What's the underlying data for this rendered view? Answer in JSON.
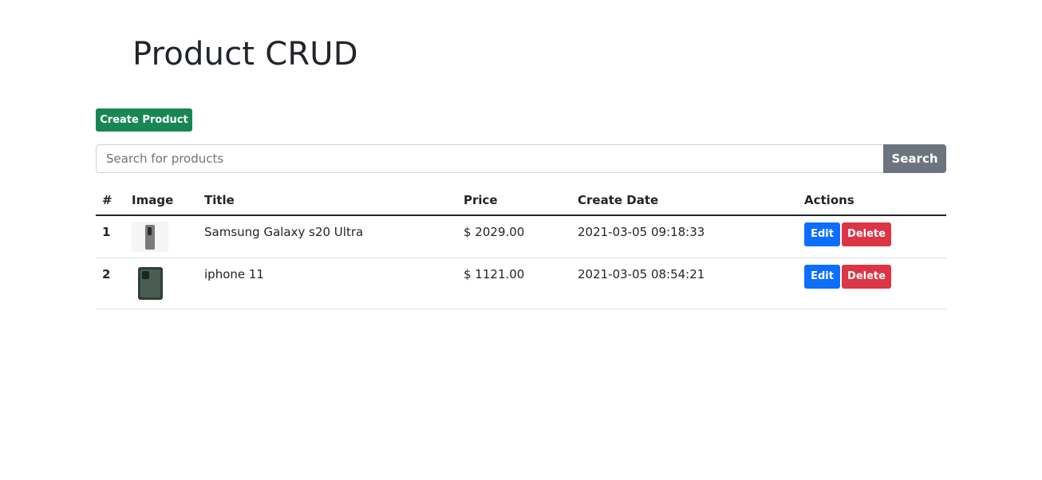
{
  "page": {
    "title": "Product CRUD",
    "create_label": "Create Product"
  },
  "search": {
    "placeholder": "Search for products",
    "button_label": "Search"
  },
  "table": {
    "headers": {
      "num": "#",
      "image": "Image",
      "title": "Title",
      "price": "Price",
      "create_date": "Create Date",
      "actions": "Actions"
    },
    "rows": [
      {
        "num": "1",
        "image_icon": "samsung-phone-thumbnail",
        "title": "Samsung Galaxy s20 Ultra",
        "price": "$ 2029.00",
        "create_date": "2021-03-05 09:18:33",
        "edit_label": "Edit",
        "delete_label": "Delete"
      },
      {
        "num": "2",
        "image_icon": "iphone-thumbnail",
        "title": "iphone 11",
        "price": "$ 1121.00",
        "create_date": "2021-03-05 08:54:21",
        "edit_label": "Edit",
        "delete_label": "Delete"
      }
    ]
  },
  "colors": {
    "create": "#198754",
    "search": "#6c757d",
    "edit": "#0d6efd",
    "delete": "#dc3545"
  }
}
